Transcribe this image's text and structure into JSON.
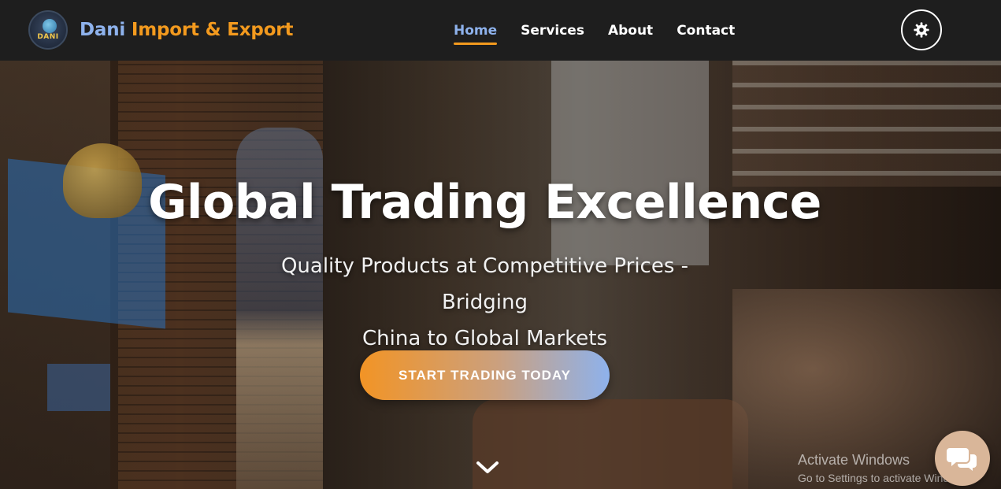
{
  "brand": {
    "logo_text": "DANI",
    "name_first": "Dani",
    "name_rest": "Import & Export"
  },
  "nav": {
    "items": [
      {
        "label": "Home",
        "active": true
      },
      {
        "label": "Services",
        "active": false
      },
      {
        "label": "About",
        "active": false
      },
      {
        "label": "Contact",
        "active": false
      }
    ],
    "settings_icon": "gear-icon"
  },
  "hero": {
    "title": "Global Trading Excellence",
    "subtitle_line1": "Quality Products at Competitive Prices - Bridging",
    "subtitle_line2": "China to Global Markets",
    "cta_label": "START TRADING TODAY",
    "scroll_icon": "chevron-down-icon"
  },
  "watermark": {
    "line1": "Activate Windows",
    "line2": "Go to Settings to activate Windows."
  },
  "chat": {
    "icon": "chat-bubbles-icon"
  },
  "colors": {
    "navbar_bg": "#1e1e1e",
    "accent_orange": "#f39a1e",
    "accent_blue": "#8eb2ec",
    "text_white": "#ffffff",
    "chat_bg": "#d9b699"
  }
}
